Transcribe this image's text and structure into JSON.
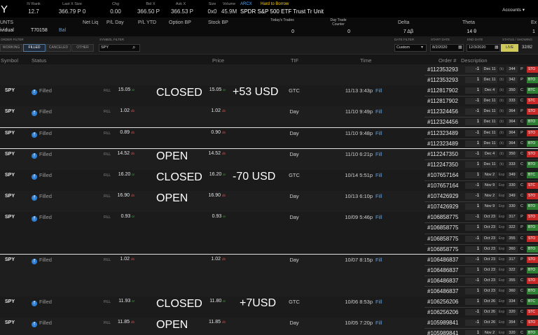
{
  "quote": {
    "symbol": "Y",
    "iv_rank_label": "IV Rank",
    "iv_rank": "12.7",
    "last_size_label": "Last X Size",
    "last_size": "366.79 P 0",
    "chg_label": "Chg",
    "chg": "0.00",
    "bid_label": "Bid X",
    "bid": "366.50 P",
    "ask_label": "Ask X",
    "ask": "366.53 P",
    "size_label": "Size",
    "size": "0x0",
    "volume_label": "Volume",
    "volume": "45.9M",
    "exchange": "ARCX",
    "htb": "Hard to Borrow",
    "description": "SPDR S&P 500 ETF Trust Tr Unit",
    "accounts_label": "Accounts"
  },
  "account": {
    "label1": "UNTS",
    "label2": "ividual",
    "account_id": "T70158",
    "bal_label": "Bal",
    "net_liq": "Net Liq",
    "pl_day": "P/L Day",
    "pl_ytd": "P/L YTD",
    "option_bp": "Option BP",
    "stock_bp": "Stock BP",
    "todays_trades_label": "Today's Trades",
    "todays_trades": "0",
    "day_trade_label": "Day Trade Counter",
    "day_trade": "0",
    "delta_label": "Delta",
    "delta": "7 Δβ",
    "theta_label": "Theta",
    "theta": "14 θ",
    "ex_label": "Ex",
    "ex": "1"
  },
  "filters": {
    "order_filter_label": "ORDER FILTER",
    "tabs": [
      "WORKING",
      "FILLED",
      "CANCELED",
      "OTHER"
    ],
    "symbol_filter_label": "SYMBOL FILTER",
    "symbol_filter": "SPY",
    "date_filter_label": "DATE FILTER",
    "date_filter": "Custom",
    "start_date_label": "START DATE",
    "start_date": "8/2/2020",
    "end_date_label": "END DATE",
    "end_date": "12/3/2020",
    "status_label": "STATUS / SHOWING",
    "live": "LIVE",
    "showing": "32/82"
  },
  "headers": {
    "symbol": "Symbol",
    "status": "Status",
    "price": "Price",
    "tif": "TIF",
    "time": "Time",
    "order": "Order #",
    "description": "Description"
  },
  "orders": [
    {
      "symbol": "",
      "status": "",
      "fill": "",
      "price1": "",
      "price2": "",
      "tif": "",
      "time": "",
      "filled": "",
      "overlay": "",
      "overlay2": "",
      "legs": [
        {
          "order": "#112353293",
          "qty": "-1",
          "date": "Dec 11",
          "exp": "(b)",
          "strike": "344",
          "type": "P",
          "action": "STO"
        },
        {
          "order": "#112353293",
          "qty": "1",
          "date": "Dec 11",
          "exp": "(b)",
          "strike": "342",
          "type": "P",
          "action": "BTO"
        }
      ]
    },
    {
      "symbol": "SPY",
      "status": "Filled",
      "fill": "FILL",
      "price1": "15.05",
      "mk1": "cr",
      "price2": "15.05",
      "mk2": "cr",
      "tif": "GTC",
      "time": "11/13 3:43p",
      "filled": "Fill",
      "overlay": "CLOSED",
      "overlay2": "+53 USD",
      "legs": [
        {
          "order": "#112817902",
          "qty": "1",
          "date": "Dec 4",
          "exp": "(b)",
          "strike": "350",
          "type": "C",
          "action": "BTC"
        },
        {
          "order": "#112817902",
          "qty": "-1",
          "date": "Dec 11",
          "exp": "(b)",
          "strike": "333",
          "type": "C",
          "action": "STC"
        }
      ]
    },
    {
      "symbol": "SPY",
      "status": "Filled",
      "fill": "FILL",
      "price1": "1.02",
      "mk1": "db",
      "price2": "1.02",
      "mk2": "db",
      "tif": "Day",
      "time": "11/10 9:49p",
      "filled": "Fill",
      "overlay": "",
      "overlay2": "",
      "legs": [
        {
          "order": "#112324456",
          "qty": "-1",
          "date": "Dec 11",
          "exp": "(b)",
          "strike": "364",
          "type": "P",
          "action": "STO"
        },
        {
          "order": "#112324456",
          "qty": "1",
          "date": "Dec 11",
          "exp": "(b)",
          "strike": "364",
          "type": "C",
          "action": "BTO"
        }
      ]
    },
    {
      "symbol": "SPY",
      "status": "Filled",
      "fill": "FILL",
      "price1": "0.89",
      "mk1": "db",
      "price2": "0.90",
      "mk2": "db",
      "tif": "Day",
      "time": "11/10 9:48p",
      "filled": "Fill",
      "overlay": "",
      "overlay2": "",
      "legs": [
        {
          "order": "#112323489",
          "qty": "-1",
          "date": "Dec 11",
          "exp": "(b)",
          "strike": "364",
          "type": "P",
          "action": "STO"
        },
        {
          "order": "#112323489",
          "qty": "1",
          "date": "Dec 11",
          "exp": "(b)",
          "strike": "364",
          "type": "C",
          "action": "BTO"
        }
      ]
    },
    {
      "symbol": "SPY",
      "status": "Filled",
      "fill": "FILL",
      "price1": "14.52",
      "mk1": "db",
      "price2": "14.52",
      "mk2": "db",
      "tif": "Day",
      "time": "11/10 6:21p",
      "filled": "Fill",
      "overlay": "OPEN",
      "overlay2": "",
      "legs": [
        {
          "order": "#112247350",
          "qty": "-1",
          "date": "Dec 4",
          "exp": "(b)",
          "strike": "350",
          "type": "C",
          "action": "STO"
        },
        {
          "order": "#112247350",
          "qty": "1",
          "date": "Dec 11",
          "exp": "(b)",
          "strike": "333",
          "type": "C",
          "action": "BTO"
        }
      ]
    },
    {
      "symbol": "SPY",
      "status": "Filled",
      "fill": "FILL",
      "price1": "16.20",
      "mk1": "cr",
      "price2": "16.20",
      "mk2": "cr",
      "tif": "GTC",
      "time": "10/14 5:51p",
      "filled": "Fill",
      "overlay": "CLOSED",
      "overlay2": "-70 USD",
      "legs": [
        {
          "order": "#107657164",
          "qty": "1",
          "date": "Nov 2",
          "exp": "Exp",
          "strike": "349",
          "type": "C",
          "action": "BTC"
        },
        {
          "order": "#107657164",
          "qty": "-1",
          "date": "Nov 9",
          "exp": "Exp",
          "strike": "330",
          "type": "C",
          "action": "STC"
        }
      ]
    },
    {
      "symbol": "SPY",
      "status": "Filled",
      "fill": "FILL",
      "price1": "16.90",
      "mk1": "db",
      "price2": "16.90",
      "mk2": "db",
      "tif": "Day",
      "time": "10/13 6:10p",
      "filled": "Fill",
      "overlay": "OPEN",
      "overlay2": "",
      "legs": [
        {
          "order": "#107426929",
          "qty": "-1",
          "date": "Nov 2",
          "exp": "Exp",
          "strike": "349",
          "type": "C",
          "action": "STO"
        },
        {
          "order": "#107426929",
          "qty": "1",
          "date": "Nov 9",
          "exp": "Exp",
          "strike": "330",
          "type": "C",
          "action": "BTO"
        }
      ]
    },
    {
      "symbol": "SPY",
      "status": "Filled",
      "fill": "FILL",
      "price1": "0.93",
      "mk1": "cr",
      "price2": "0.93",
      "mk2": "cr",
      "tif": "Day",
      "time": "10/09 5:46p",
      "filled": "Fill",
      "overlay": "",
      "overlay2": "",
      "legs": [
        {
          "order": "#106858775",
          "qty": "-1",
          "date": "Oct 23",
          "exp": "Exp",
          "strike": "317",
          "type": "P",
          "action": "STO"
        },
        {
          "order": "#106858775",
          "qty": "1",
          "date": "Oct 23",
          "exp": "Exp",
          "strike": "322",
          "type": "P",
          "action": "BTO"
        },
        {
          "order": "#106858775",
          "qty": "-1",
          "date": "Oct 23",
          "exp": "Exp",
          "strike": "355",
          "type": "C",
          "action": "STO"
        },
        {
          "order": "#106858775",
          "qty": "1",
          "date": "Oct 23",
          "exp": "Exp",
          "strike": "360",
          "type": "C",
          "action": "BTO"
        }
      ]
    },
    {
      "symbol": "SPY",
      "status": "Filled",
      "fill": "FILL",
      "price1": "1.02",
      "mk1": "db",
      "price2": "1.02",
      "mk2": "db",
      "tif": "Day",
      "time": "10/07 8:15p",
      "filled": "Fill",
      "overlay": "",
      "overlay2": "",
      "legs": [
        {
          "order": "#106486837",
          "qty": "-1",
          "date": "Oct 23",
          "exp": "Exp",
          "strike": "317",
          "type": "P",
          "action": "STO"
        },
        {
          "order": "#106486837",
          "qty": "1",
          "date": "Oct 23",
          "exp": "Exp",
          "strike": "322",
          "type": "P",
          "action": "BTO"
        },
        {
          "order": "#106486837",
          "qty": "-1",
          "date": "Oct 23",
          "exp": "Exp",
          "strike": "355",
          "type": "C",
          "action": "STO"
        },
        {
          "order": "#106486837",
          "qty": "1",
          "date": "Oct 23",
          "exp": "Exp",
          "strike": "360",
          "type": "C",
          "action": "BTO"
        }
      ]
    },
    {
      "symbol": "SPY",
      "status": "Filled",
      "fill": "FILL",
      "price1": "11.93",
      "mk1": "cr",
      "price2": "11.80",
      "mk2": "cr",
      "tif": "GTC",
      "time": "10/06 8:53p",
      "filled": "Fill",
      "overlay": "CLOSED",
      "overlay2": "+7USD",
      "legs": [
        {
          "order": "#106256206",
          "qty": "1",
          "date": "Oct 26",
          "exp": "Exp",
          "strike": "334",
          "type": "C",
          "action": "BTC"
        },
        {
          "order": "#106256206",
          "qty": "-1",
          "date": "Oct 26",
          "exp": "Exp",
          "strike": "320",
          "type": "C",
          "action": "STC"
        }
      ]
    },
    {
      "symbol": "SPY",
      "status": "Filled",
      "fill": "FILL",
      "price1": "11.85",
      "mk1": "db",
      "price2": "11.85",
      "mk2": "db",
      "tif": "Day",
      "time": "10/05 7:20p",
      "filled": "Fill",
      "overlay": "OPEN",
      "overlay2": "",
      "legs": [
        {
          "order": "#105989841",
          "qty": "-1",
          "date": "Oct 26",
          "exp": "Exp",
          "strike": "354",
          "type": "C",
          "action": "STO"
        },
        {
          "order": "#105989841",
          "qty": "1",
          "date": "Nov 2",
          "exp": "Exp",
          "strike": "320",
          "type": "C",
          "action": "BTO"
        }
      ]
    }
  ]
}
